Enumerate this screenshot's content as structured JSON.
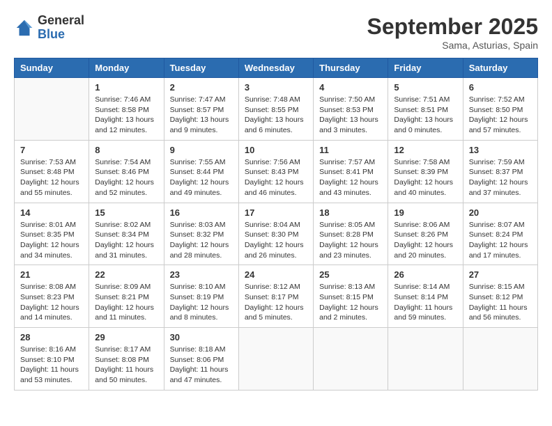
{
  "header": {
    "logo_general": "General",
    "logo_blue": "Blue",
    "month_title": "September 2025",
    "location": "Sama, Asturias, Spain"
  },
  "days_of_week": [
    "Sunday",
    "Monday",
    "Tuesday",
    "Wednesday",
    "Thursday",
    "Friday",
    "Saturday"
  ],
  "weeks": [
    [
      {
        "day": "",
        "sunrise": "",
        "sunset": "",
        "daylight": ""
      },
      {
        "day": "1",
        "sunrise": "Sunrise: 7:46 AM",
        "sunset": "Sunset: 8:58 PM",
        "daylight": "Daylight: 13 hours and 12 minutes."
      },
      {
        "day": "2",
        "sunrise": "Sunrise: 7:47 AM",
        "sunset": "Sunset: 8:57 PM",
        "daylight": "Daylight: 13 hours and 9 minutes."
      },
      {
        "day": "3",
        "sunrise": "Sunrise: 7:48 AM",
        "sunset": "Sunset: 8:55 PM",
        "daylight": "Daylight: 13 hours and 6 minutes."
      },
      {
        "day": "4",
        "sunrise": "Sunrise: 7:50 AM",
        "sunset": "Sunset: 8:53 PM",
        "daylight": "Daylight: 13 hours and 3 minutes."
      },
      {
        "day": "5",
        "sunrise": "Sunrise: 7:51 AM",
        "sunset": "Sunset: 8:51 PM",
        "daylight": "Daylight: 13 hours and 0 minutes."
      },
      {
        "day": "6",
        "sunrise": "Sunrise: 7:52 AM",
        "sunset": "Sunset: 8:50 PM",
        "daylight": "Daylight: 12 hours and 57 minutes."
      }
    ],
    [
      {
        "day": "7",
        "sunrise": "Sunrise: 7:53 AM",
        "sunset": "Sunset: 8:48 PM",
        "daylight": "Daylight: 12 hours and 55 minutes."
      },
      {
        "day": "8",
        "sunrise": "Sunrise: 7:54 AM",
        "sunset": "Sunset: 8:46 PM",
        "daylight": "Daylight: 12 hours and 52 minutes."
      },
      {
        "day": "9",
        "sunrise": "Sunrise: 7:55 AM",
        "sunset": "Sunset: 8:44 PM",
        "daylight": "Daylight: 12 hours and 49 minutes."
      },
      {
        "day": "10",
        "sunrise": "Sunrise: 7:56 AM",
        "sunset": "Sunset: 8:43 PM",
        "daylight": "Daylight: 12 hours and 46 minutes."
      },
      {
        "day": "11",
        "sunrise": "Sunrise: 7:57 AM",
        "sunset": "Sunset: 8:41 PM",
        "daylight": "Daylight: 12 hours and 43 minutes."
      },
      {
        "day": "12",
        "sunrise": "Sunrise: 7:58 AM",
        "sunset": "Sunset: 8:39 PM",
        "daylight": "Daylight: 12 hours and 40 minutes."
      },
      {
        "day": "13",
        "sunrise": "Sunrise: 7:59 AM",
        "sunset": "Sunset: 8:37 PM",
        "daylight": "Daylight: 12 hours and 37 minutes."
      }
    ],
    [
      {
        "day": "14",
        "sunrise": "Sunrise: 8:01 AM",
        "sunset": "Sunset: 8:35 PM",
        "daylight": "Daylight: 12 hours and 34 minutes."
      },
      {
        "day": "15",
        "sunrise": "Sunrise: 8:02 AM",
        "sunset": "Sunset: 8:34 PM",
        "daylight": "Daylight: 12 hours and 31 minutes."
      },
      {
        "day": "16",
        "sunrise": "Sunrise: 8:03 AM",
        "sunset": "Sunset: 8:32 PM",
        "daylight": "Daylight: 12 hours and 28 minutes."
      },
      {
        "day": "17",
        "sunrise": "Sunrise: 8:04 AM",
        "sunset": "Sunset: 8:30 PM",
        "daylight": "Daylight: 12 hours and 26 minutes."
      },
      {
        "day": "18",
        "sunrise": "Sunrise: 8:05 AM",
        "sunset": "Sunset: 8:28 PM",
        "daylight": "Daylight: 12 hours and 23 minutes."
      },
      {
        "day": "19",
        "sunrise": "Sunrise: 8:06 AM",
        "sunset": "Sunset: 8:26 PM",
        "daylight": "Daylight: 12 hours and 20 minutes."
      },
      {
        "day": "20",
        "sunrise": "Sunrise: 8:07 AM",
        "sunset": "Sunset: 8:24 PM",
        "daylight": "Daylight: 12 hours and 17 minutes."
      }
    ],
    [
      {
        "day": "21",
        "sunrise": "Sunrise: 8:08 AM",
        "sunset": "Sunset: 8:23 PM",
        "daylight": "Daylight: 12 hours and 14 minutes."
      },
      {
        "day": "22",
        "sunrise": "Sunrise: 8:09 AM",
        "sunset": "Sunset: 8:21 PM",
        "daylight": "Daylight: 12 hours and 11 minutes."
      },
      {
        "day": "23",
        "sunrise": "Sunrise: 8:10 AM",
        "sunset": "Sunset: 8:19 PM",
        "daylight": "Daylight: 12 hours and 8 minutes."
      },
      {
        "day": "24",
        "sunrise": "Sunrise: 8:12 AM",
        "sunset": "Sunset: 8:17 PM",
        "daylight": "Daylight: 12 hours and 5 minutes."
      },
      {
        "day": "25",
        "sunrise": "Sunrise: 8:13 AM",
        "sunset": "Sunset: 8:15 PM",
        "daylight": "Daylight: 12 hours and 2 minutes."
      },
      {
        "day": "26",
        "sunrise": "Sunrise: 8:14 AM",
        "sunset": "Sunset: 8:14 PM",
        "daylight": "Daylight: 11 hours and 59 minutes."
      },
      {
        "day": "27",
        "sunrise": "Sunrise: 8:15 AM",
        "sunset": "Sunset: 8:12 PM",
        "daylight": "Daylight: 11 hours and 56 minutes."
      }
    ],
    [
      {
        "day": "28",
        "sunrise": "Sunrise: 8:16 AM",
        "sunset": "Sunset: 8:10 PM",
        "daylight": "Daylight: 11 hours and 53 minutes."
      },
      {
        "day": "29",
        "sunrise": "Sunrise: 8:17 AM",
        "sunset": "Sunset: 8:08 PM",
        "daylight": "Daylight: 11 hours and 50 minutes."
      },
      {
        "day": "30",
        "sunrise": "Sunrise: 8:18 AM",
        "sunset": "Sunset: 8:06 PM",
        "daylight": "Daylight: 11 hours and 47 minutes."
      },
      {
        "day": "",
        "sunrise": "",
        "sunset": "",
        "daylight": ""
      },
      {
        "day": "",
        "sunrise": "",
        "sunset": "",
        "daylight": ""
      },
      {
        "day": "",
        "sunrise": "",
        "sunset": "",
        "daylight": ""
      },
      {
        "day": "",
        "sunrise": "",
        "sunset": "",
        "daylight": ""
      }
    ]
  ]
}
